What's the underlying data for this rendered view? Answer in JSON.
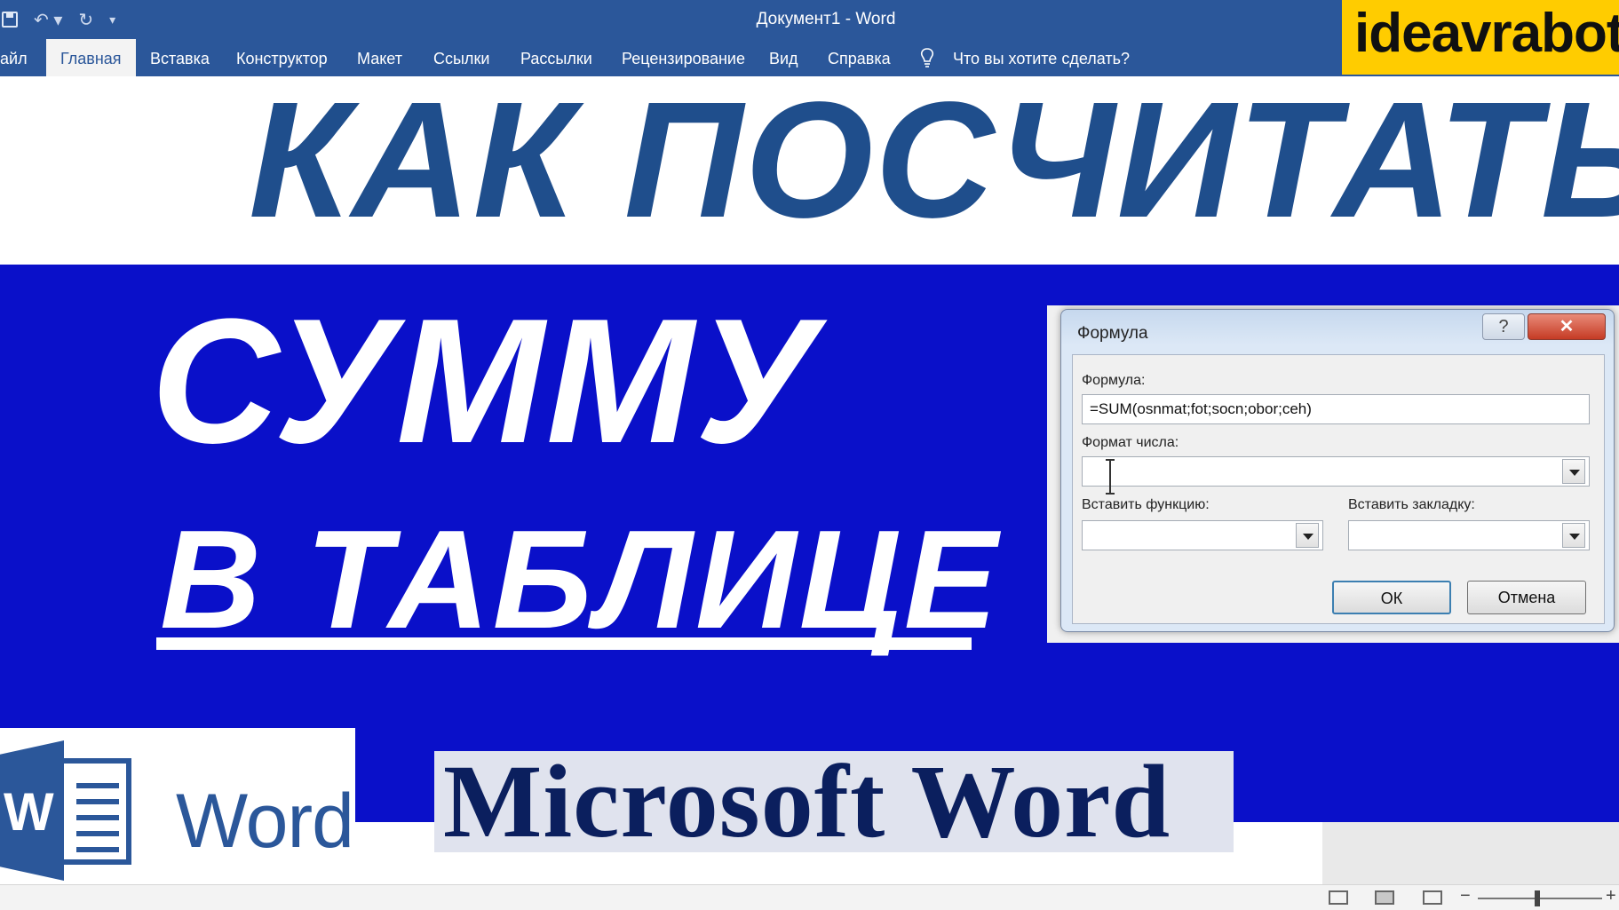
{
  "window": {
    "title": "Документ1  -  Word"
  },
  "ribbon": {
    "tabs": [
      {
        "label": "айл"
      },
      {
        "label": "Главная"
      },
      {
        "label": "Вставка"
      },
      {
        "label": "Конструктор"
      },
      {
        "label": "Макет"
      },
      {
        "label": "Ссылки"
      },
      {
        "label": "Рассылки"
      },
      {
        "label": "Рецензирование"
      },
      {
        "label": "Вид"
      },
      {
        "label": "Справка"
      }
    ],
    "active_tab": "Главная",
    "tell_me": "Что вы хотите сделать?"
  },
  "brand": {
    "text": "ideavrabote."
  },
  "headline": {
    "line1": "КАК ПОСЧИТАТЬ",
    "line2": "СУММУ",
    "line3": "В ТАБЛИЦЕ"
  },
  "dialog": {
    "title": "Формула",
    "help_label": "?",
    "close_label": "✕",
    "formula_label": "Формула:",
    "formula_value": "=SUM(osnmat;fot;socn;obor;ceh)",
    "number_format_label": "Формат числа:",
    "number_format_value": "",
    "insert_function_label": "Вставить функцию:",
    "insert_bookmark_label": "Вставить закладку:",
    "ok_label": "ОК",
    "cancel_label": "Отмена"
  },
  "logo": {
    "glyph": "W",
    "text": "Word"
  },
  "footer": {
    "product": "Microsoft Word"
  },
  "colors": {
    "word_blue": "#2b579a",
    "band_blue": "#0a10c9",
    "heading_blue": "#1f4e8c",
    "brand_yellow": "#ffcc00"
  }
}
